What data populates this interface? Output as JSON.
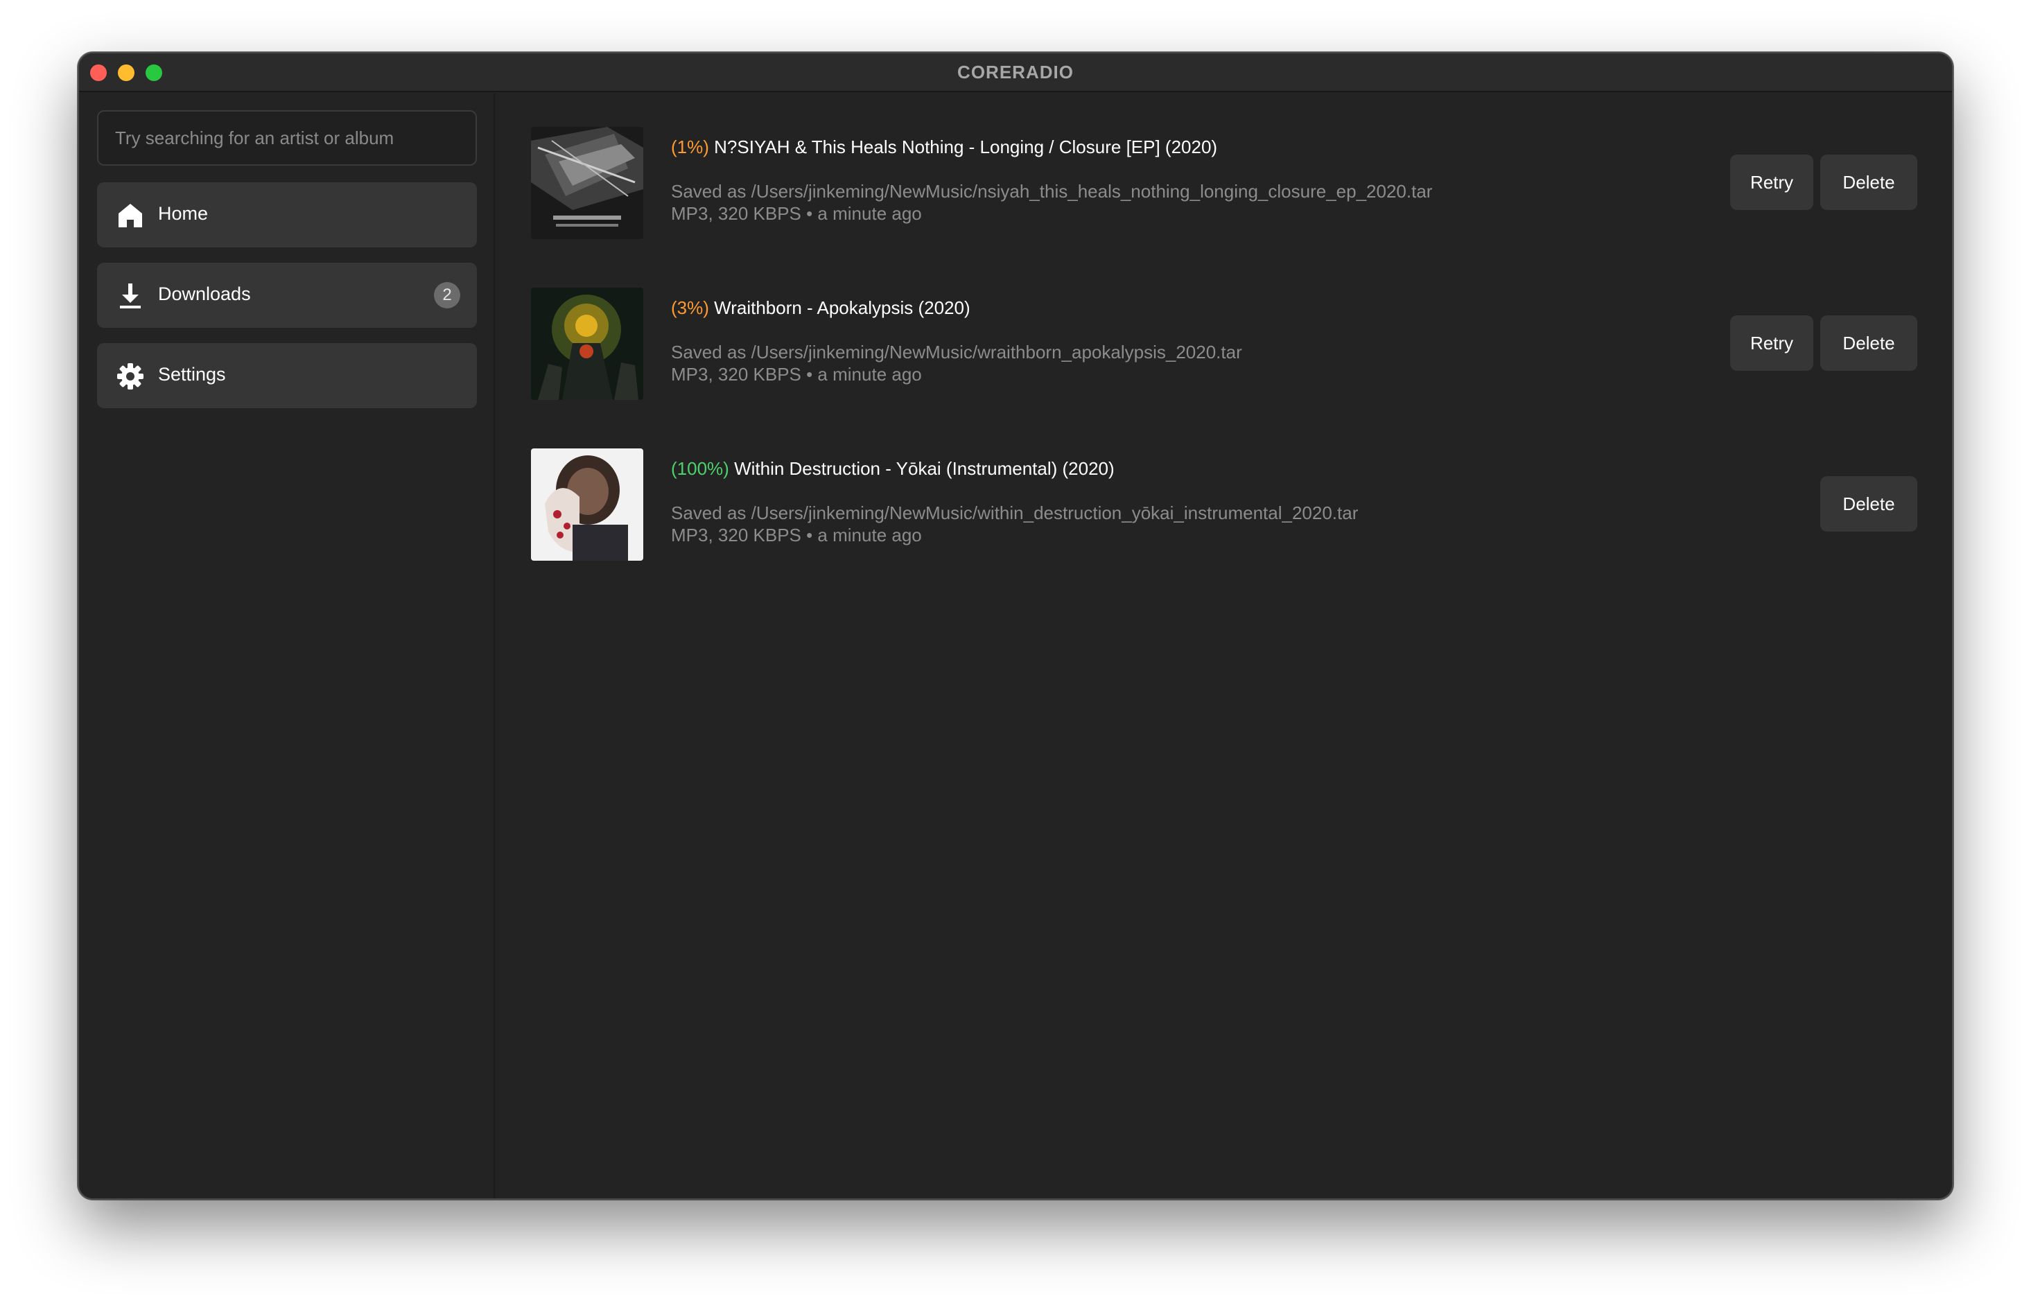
{
  "window": {
    "title": "CORERADIO"
  },
  "sidebar": {
    "search_placeholder": "Try searching for an artist or album",
    "items": [
      {
        "label": "Home",
        "icon": "home-icon"
      },
      {
        "label": "Downloads",
        "icon": "download-icon",
        "badge": "2"
      },
      {
        "label": "Settings",
        "icon": "gear-icon"
      }
    ]
  },
  "downloads": [
    {
      "percent": "(1%)",
      "title": "N?SIYAH & This Heals Nothing - Longing / Closure [EP] (2020)",
      "path": "Saved as /Users/jinkeming/NewMusic/nsiyah_this_heals_nothing_longing_closure_ep_2020.tar",
      "meta": "MP3, 320 KBPS • a minute ago",
      "retry": "Retry",
      "delete": "Delete",
      "status_color": "#ff9a2e"
    },
    {
      "percent": "(3%)",
      "title": "Wraithborn - Apokalypsis (2020)",
      "path": "Saved as /Users/jinkeming/NewMusic/wraithborn_apokalypsis_2020.tar",
      "meta": "MP3, 320 KBPS • a minute ago",
      "retry": "Retry",
      "delete": "Delete",
      "status_color": "#ff9a2e"
    },
    {
      "percent": "(100%)",
      "title": "Within Destruction - Yōkai (Instrumental) (2020)",
      "path": "Saved as /Users/jinkeming/NewMusic/within_destruction_yōkai_instrumental_2020.tar",
      "meta": "MP3, 320 KBPS • a minute ago",
      "delete": "Delete",
      "status_color": "#4cd26a"
    }
  ]
}
